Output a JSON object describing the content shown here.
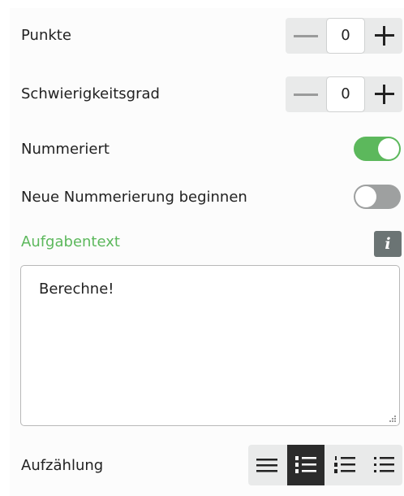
{
  "fields": {
    "points": {
      "label": "Punkte",
      "value": "0"
    },
    "difficulty": {
      "label": "Schwierigkeitsgrad",
      "value": "0"
    },
    "numbered": {
      "label": "Nummeriert",
      "on": true
    },
    "restart_numbering": {
      "label": "Neue Nummerierung beginnen",
      "on": false
    }
  },
  "task_text": {
    "label": "Aufgabentext",
    "info_icon": "i",
    "value": "Berechne!"
  },
  "list_style": {
    "label": "Aufzählung",
    "options": [
      "lines-icon",
      "lettered-list-icon",
      "numbered-list-icon",
      "bullet-list-icon"
    ],
    "selected": "lettered-list-icon"
  },
  "colors": {
    "accent_green": "#5cb85c",
    "toggle_off": "#9ea0a0",
    "info_button": "#6b7474"
  }
}
